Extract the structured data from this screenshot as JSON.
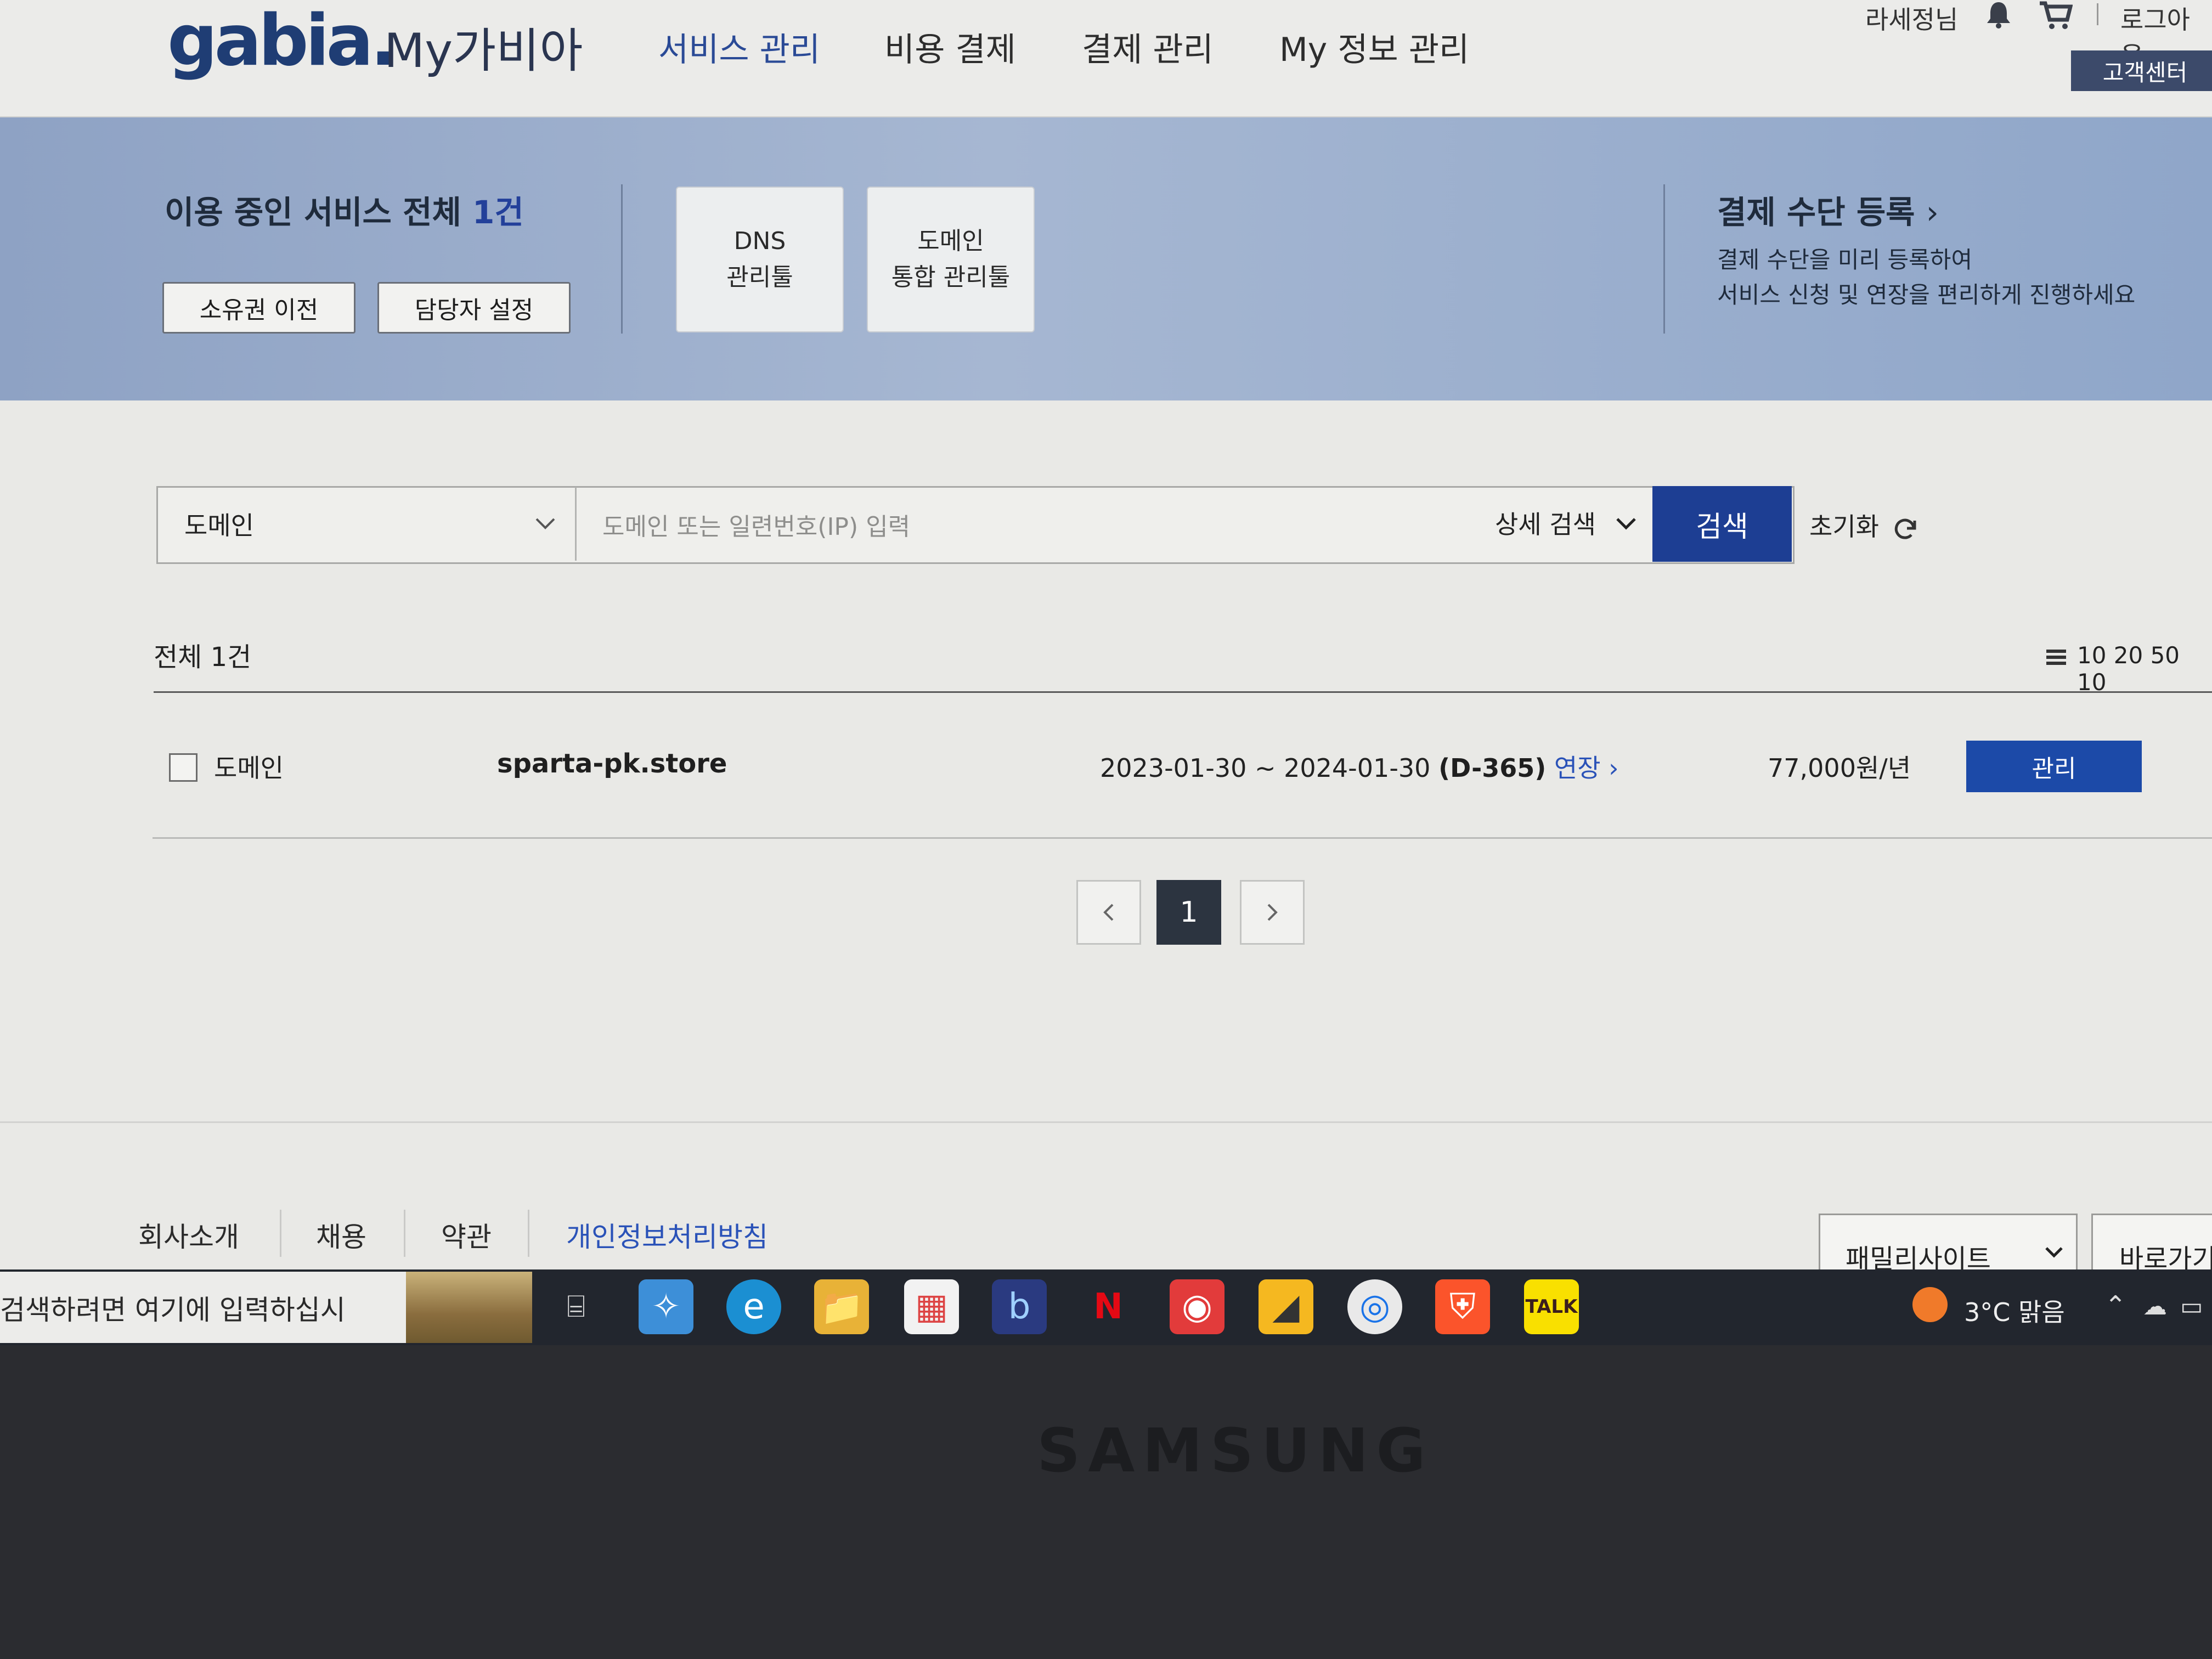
{
  "header": {
    "logo": "gabia.",
    "logo_sub": "My가비아",
    "nav": [
      "서비스 관리",
      "비용 결제",
      "결제 관리",
      "My 정보 관리"
    ],
    "user_name": "라세정님",
    "logout": "로그아웃",
    "customer_center": "고객센터"
  },
  "banner": {
    "services_label": "이용 중인 서비스 전체 ",
    "services_count": "1건",
    "transfer_button": "소유권 이전",
    "manager_button": "담당자 설정",
    "dns_tool_line1": "DNS",
    "dns_tool_line2": "관리툴",
    "domain_tool_line1": "도메인",
    "domain_tool_line2": "통합 관리툴",
    "payment_title": "결제 수단 등록",
    "payment_desc_line1": "결제 수단을 미리 등록하여",
    "payment_desc_line2": "서비스 신청 및 연장을 편리하게 진행하세요"
  },
  "search": {
    "type_selected": "도메인",
    "placeholder": "도메인 또는 일련번호(IP) 입력",
    "detail_search": "상세 검색",
    "search_button": "검색",
    "reset": "초기화"
  },
  "list": {
    "total": "전체 1건",
    "per_page": "10 20 50 10",
    "rows": [
      {
        "type": "도메인",
        "domain": "sparta-pk.store",
        "period": "2023-01-30 ~ 2024-01-30",
        "dday": "(D-365)",
        "renew": "연장",
        "price": "77,000원/년",
        "manage": "관리"
      }
    ]
  },
  "pagination": {
    "current": "1"
  },
  "footer": {
    "links": [
      "회사소개",
      "채용",
      "약관",
      "개인정보처리방침"
    ],
    "family_site": "패밀리사이트",
    "shortcut": "바로가기"
  },
  "taskbar": {
    "search_placeholder": "검색하려면 여기에 입력하십시",
    "weather": "3°C  맑음"
  },
  "bezel": {
    "brand": "SAMSUNG"
  },
  "colors": {
    "brand_blue": "#1d3e93",
    "banner": "#9aaecd",
    "accent_link": "#2a52b8"
  }
}
